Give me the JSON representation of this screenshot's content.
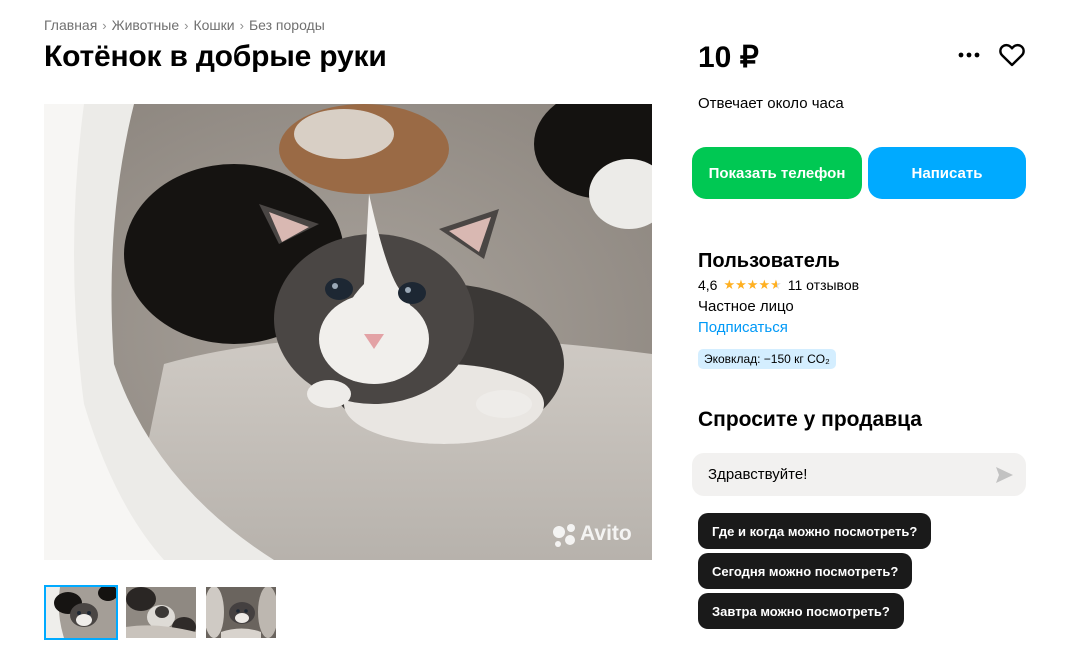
{
  "breadcrumbs": [
    "Главная",
    "Животные",
    "Кошки",
    "Без породы"
  ],
  "title": "Котёнок в добрые руки",
  "price": "10 ₽",
  "response_time": "Отвечает около часа",
  "buttons": {
    "show_phone": "Показать телефон",
    "write": "Написать"
  },
  "icons": {
    "more": "more-horizontal-icon",
    "favorite": "heart-icon",
    "send": "send-arrow-icon",
    "star": "star-icon"
  },
  "gallery": {
    "watermark": "Avito",
    "thumbnail_count": 3,
    "active_thumbnail": 1
  },
  "seller": {
    "name": "Пользователь",
    "rating": "4,6",
    "stars_filled": 4.6,
    "reviews": "11 отзывов",
    "type": "Частное лицо",
    "subscribe": "Подписаться",
    "eco_badge": "Эковклад: −150 кг CO₂"
  },
  "ask_seller": {
    "title": "Спросите у продавца",
    "message": "Здравствуйте!",
    "suggestions": [
      "Где и когда можно посмотреть?",
      "Сегодня можно посмотреть?",
      "Завтра можно посмотреть?"
    ]
  },
  "colors": {
    "accent_green": "#00c853",
    "accent_blue": "#00aaff",
    "link_blue": "#0099f7",
    "star": "#ffb021",
    "chip_bg": "#1a1a1a",
    "badge_bg": "#d4eeff"
  }
}
